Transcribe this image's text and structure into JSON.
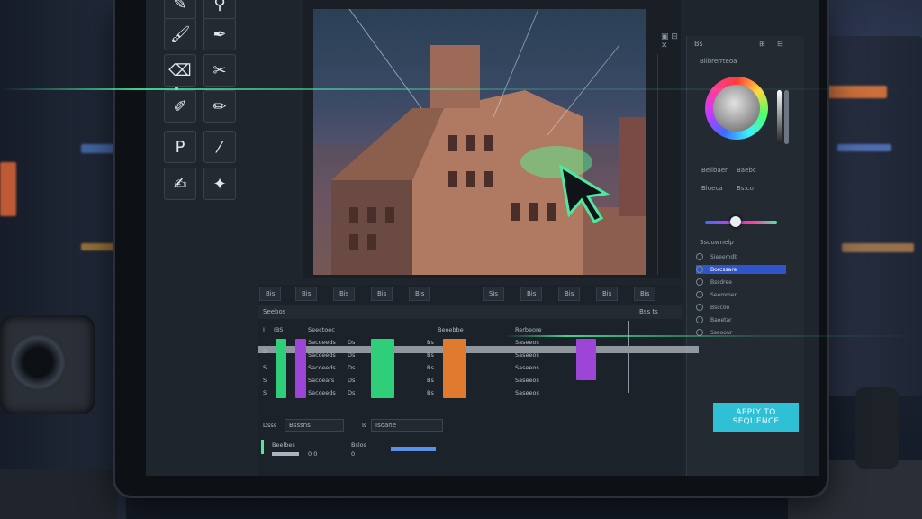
{
  "tools": {
    "items": [
      "brush-icon",
      "eyedropper-icon",
      "fill-icon",
      "pen-icon",
      "eraser-icon",
      "cut-icon",
      "type-icon",
      "pencil-icon",
      "edit-icon",
      "magic-icon"
    ]
  },
  "viewer": {
    "top_icons": "▣ ⊟ ✕"
  },
  "right_panel": {
    "header_icons": [
      "Bs",
      "⊞",
      "⊟"
    ],
    "section_label": "Bilbrerrteoa",
    "grading_labels": [
      "Bellbaer",
      "Baebc",
      "Blueca",
      "Bs:co"
    ],
    "list_header": "Ssouwnelp",
    "list_items": [
      "Sieeemdb",
      "Borcssare",
      "Bssdree",
      "Seemmer",
      "Bsccoo",
      "Baoetar",
      "Sseoour"
    ],
    "selected_index": 1
  },
  "timeline": {
    "chips": [
      "Bis",
      "Bis",
      "Bis",
      "Bis",
      "Bis",
      "Sis",
      "Bis",
      "Bis",
      "Bis",
      "Bis"
    ],
    "header_left": "Seebos",
    "header_right": "Bss ts",
    "tracks_header": [
      "I",
      "IBS",
      "Seectoec",
      "Beoebbe",
      "Rerbeore"
    ],
    "rows": [
      {
        "name": "Sacceeds",
        "code": "Ds",
        "b": "Bs",
        "c": "Saseeos"
      },
      {
        "name": "Sacceeds",
        "code": "Ds",
        "b": "Bs",
        "c": "Saseeos"
      },
      {
        "name": "Sacceeds",
        "code": "Ds",
        "b": "Bs",
        "c": "Saseeos"
      },
      {
        "name": "Saccears",
        "code": "Ds",
        "b": "Bs",
        "c": "Saseeos"
      },
      {
        "name": "Secceeds",
        "code": "Ds",
        "b": "Bs",
        "c": "Saseeos"
      }
    ]
  },
  "bottom_controls": {
    "field_a_label": "Dsss",
    "field_a_value": "Bsssns",
    "field_b_label": "Is",
    "field_b_value": "Isoane",
    "row2_left": "Beelbes",
    "row2_mid": "0 0",
    "row2_val": "Bslos",
    "row2_num": "0"
  },
  "apply_button": {
    "label": "APPLY TO SEQUENCE"
  },
  "colors": {
    "accent_green": "#4fe8a0",
    "apply_cyan": "#2fc0d6",
    "selection_blue": "#2f56c8",
    "clip_green": "#2fcf7a",
    "clip_purple": "#9c45d6",
    "clip_orange": "#e07a2f"
  }
}
